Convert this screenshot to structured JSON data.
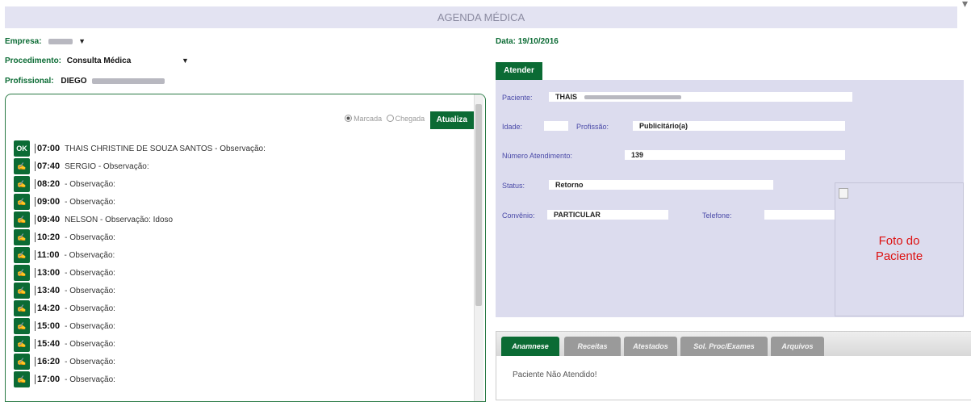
{
  "header": {
    "title": "AGENDA MÉDICA",
    "close_icon": "close-icon"
  },
  "filters": {
    "empresa_label": "Empresa:",
    "procedimento_label": "Procedimento:",
    "procedimento_value": "Consulta Médica",
    "profissional_label": "Profissional:",
    "profissional_value": "DIEGO"
  },
  "schedule": {
    "radio_marcada": "Marcada",
    "radio_chegada": "Chegada",
    "atualiza_button": "Atualiza",
    "slots": [
      {
        "icon": "OK",
        "time": "07:00",
        "desc": "THAIS CHRISTINE DE SOUZA SANTOS - Observação:"
      },
      {
        "icon": "✍",
        "time": "07:40",
        "desc": "SERGIO - Observação:"
      },
      {
        "icon": "✍",
        "time": "08:20",
        "desc": "- Observação:"
      },
      {
        "icon": "✍",
        "time": "09:00",
        "desc": "- Observação:"
      },
      {
        "icon": "✍",
        "time": "09:40",
        "desc": "NELSON - Observação: Idoso"
      },
      {
        "icon": "✍",
        "time": "10:20",
        "desc": "- Observação:"
      },
      {
        "icon": "✍",
        "time": "11:00",
        "desc": "- Observação:"
      },
      {
        "icon": "✍",
        "time": "13:00",
        "desc": "- Observação:"
      },
      {
        "icon": "✍",
        "time": "13:40",
        "desc": "- Observação:"
      },
      {
        "icon": "✍",
        "time": "14:20",
        "desc": "- Observação:"
      },
      {
        "icon": "✍",
        "time": "15:00",
        "desc": "- Observação:"
      },
      {
        "icon": "✍",
        "time": "15:40",
        "desc": "- Observação:"
      },
      {
        "icon": "✍",
        "time": "16:20",
        "desc": "- Observação:"
      },
      {
        "icon": "✍",
        "time": "17:00",
        "desc": "- Observação:"
      }
    ]
  },
  "patient": {
    "date_label": "Data:",
    "date_value": "19/10/2016",
    "atender_tab": "Atender",
    "paciente_label": "Paciente:",
    "paciente_value": "THAIS",
    "idade_label": "Idade:",
    "profissao_label": "Profissão:",
    "profissao_value": "Publicitário(a)",
    "numero_label": "Número Atendimento:",
    "numero_value": "139",
    "status_label": "Status:",
    "status_value": "Retorno",
    "convenio_label": "Convênio:",
    "convenio_value": "PARTICULAR",
    "telefone_label": "Telefone:",
    "photo_line1": "Foto do",
    "photo_line2": "Paciente"
  },
  "tabs": {
    "items": [
      "Anamnese",
      "Receitas",
      "Atestados",
      "Sol. Proc/Exames",
      "Arquivos"
    ],
    "active": 0,
    "content": "Paciente Não Atendido!"
  }
}
